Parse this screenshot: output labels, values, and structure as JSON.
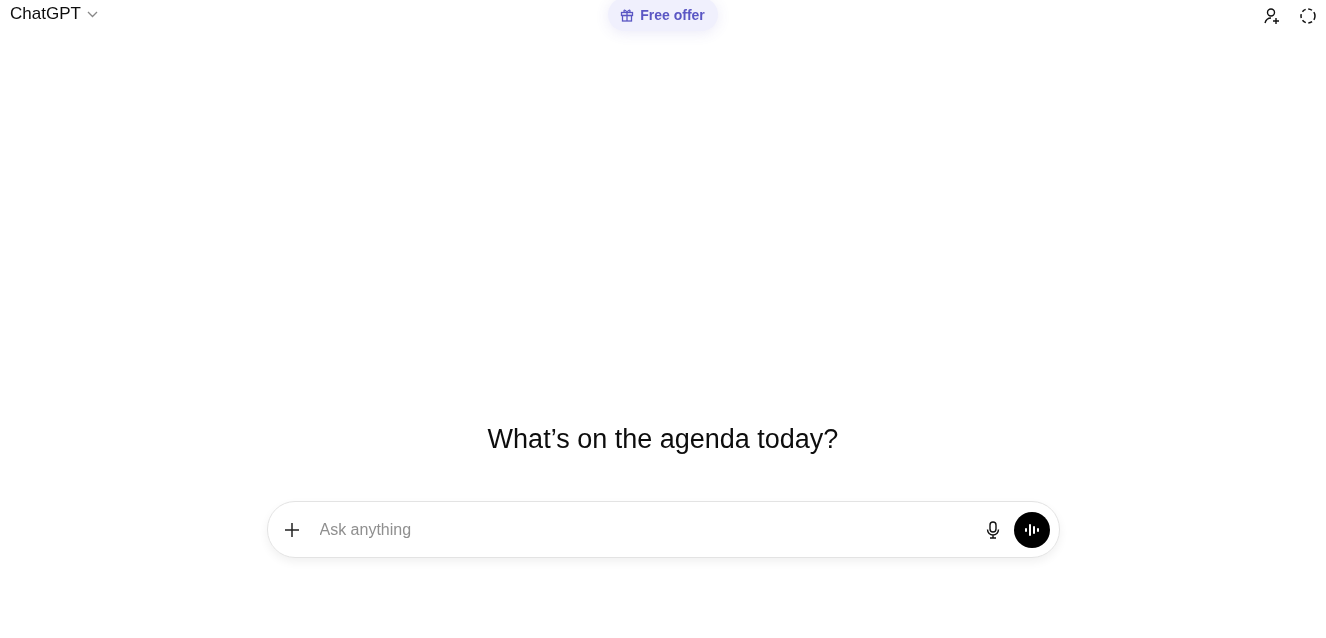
{
  "header": {
    "model_name": "ChatGPT",
    "offer_label": "Free offer"
  },
  "heading": "What’s on the agenda today?",
  "composer": {
    "placeholder": "Ask anything"
  }
}
